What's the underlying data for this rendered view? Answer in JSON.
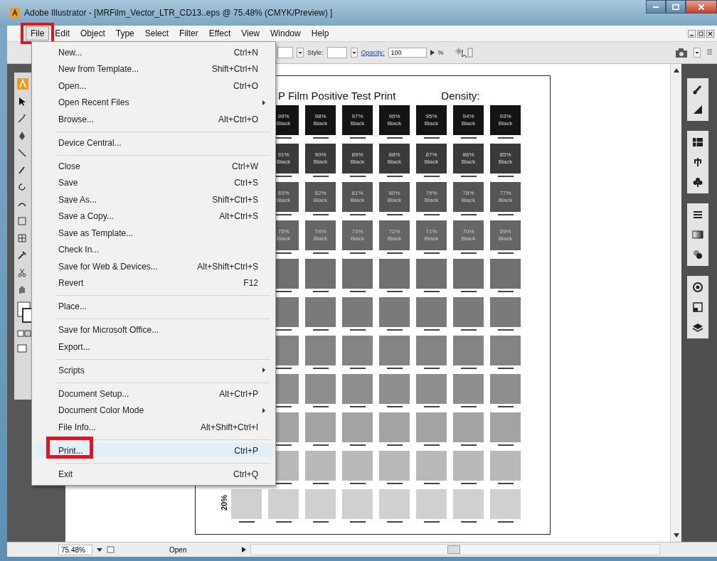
{
  "window": {
    "title": "Adobe Illustrator - [MRFilm_Vector_LTR_CD13..eps @ 75.48% (CMYK/Preview) ]"
  },
  "menu_bar": [
    {
      "label": "File",
      "selected": true,
      "marked": true
    },
    {
      "label": "Edit",
      "selected": false,
      "marked": false
    },
    {
      "label": "Object",
      "selected": false,
      "marked": false
    },
    {
      "label": "Type",
      "selected": false,
      "marked": false
    },
    {
      "label": "Select",
      "selected": false,
      "marked": false
    },
    {
      "label": "Filter",
      "selected": false,
      "marked": false
    },
    {
      "label": "Effect",
      "selected": false,
      "marked": false
    },
    {
      "label": "View",
      "selected": false,
      "marked": false
    },
    {
      "label": "Window",
      "selected": false,
      "marked": false
    },
    {
      "label": "Help",
      "selected": false,
      "marked": false
    }
  ],
  "control_bar": {
    "style_label": "Style:",
    "opacity_label": "Opacity:",
    "opacity_value": "100",
    "percent": "%"
  },
  "file_menu": [
    {
      "label": "New...",
      "shortcut": "Ctrl+N",
      "separator_before": false,
      "submenu": false,
      "selected": false,
      "marked": false
    },
    {
      "label": "New from Template...",
      "shortcut": "Shift+Ctrl+N",
      "separator_before": false,
      "submenu": false,
      "selected": false,
      "marked": false
    },
    {
      "label": "Open...",
      "shortcut": "Ctrl+O",
      "separator_before": false,
      "submenu": false,
      "selected": false,
      "marked": false
    },
    {
      "label": "Open Recent Files",
      "separator_before": false,
      "submenu": true,
      "selected": false,
      "marked": false
    },
    {
      "label": "Browse...",
      "shortcut": "Alt+Ctrl+O",
      "separator_before": false,
      "submenu": false,
      "selected": false,
      "marked": false
    },
    {
      "label": "Device Central...",
      "separator_before": true,
      "submenu": false,
      "selected": false,
      "marked": false
    },
    {
      "label": "Close",
      "shortcut": "Ctrl+W",
      "separator_before": true,
      "submenu": false,
      "selected": false,
      "marked": false
    },
    {
      "label": "Save",
      "shortcut": "Ctrl+S",
      "separator_before": false,
      "submenu": false,
      "selected": false,
      "marked": false
    },
    {
      "label": "Save As...",
      "shortcut": "Shift+Ctrl+S",
      "separator_before": false,
      "submenu": false,
      "selected": false,
      "marked": false
    },
    {
      "label": "Save a Copy...",
      "shortcut": "Alt+Ctrl+S",
      "separator_before": false,
      "submenu": false,
      "selected": false,
      "marked": false
    },
    {
      "label": "Save as Template...",
      "separator_before": false,
      "submenu": false,
      "selected": false,
      "marked": false
    },
    {
      "label": "Check In...",
      "separator_before": false,
      "submenu": false,
      "selected": false,
      "marked": false
    },
    {
      "label": "Save for Web & Devices...",
      "shortcut": "Alt+Shift+Ctrl+S",
      "separator_before": false,
      "submenu": false,
      "selected": false,
      "marked": false
    },
    {
      "label": "Revert",
      "shortcut": "F12",
      "separator_before": false,
      "submenu": false,
      "selected": false,
      "marked": false
    },
    {
      "label": "Place...",
      "separator_before": true,
      "submenu": false,
      "selected": false,
      "marked": false
    },
    {
      "label": "Save for Microsoft Office...",
      "separator_before": true,
      "submenu": false,
      "selected": false,
      "marked": false
    },
    {
      "label": "Export...",
      "separator_before": false,
      "submenu": false,
      "selected": false,
      "marked": false
    },
    {
      "label": "Scripts",
      "separator_before": true,
      "submenu": true,
      "selected": false,
      "marked": false
    },
    {
      "label": "Document Setup...",
      "shortcut": "Alt+Ctrl+P",
      "separator_before": true,
      "submenu": false,
      "selected": false,
      "marked": false
    },
    {
      "label": "Document Color Mode",
      "separator_before": false,
      "submenu": true,
      "selected": false,
      "marked": false
    },
    {
      "label": "File Info...",
      "shortcut": "Alt+Shift+Ctrl+I",
      "separator_before": false,
      "submenu": false,
      "selected": false,
      "marked": false
    },
    {
      "label": "Print...",
      "shortcut": "Ctrl+P",
      "separator_before": true,
      "submenu": false,
      "selected": true,
      "marked": true
    },
    {
      "label": "Exit",
      "shortcut": "Ctrl+Q",
      "separator_before": true,
      "submenu": false,
      "selected": false,
      "marked": false
    }
  ],
  "document": {
    "title": "P Film Positive Test Print",
    "density_label": "Density:",
    "rows": [
      {
        "color": "#141414",
        "cells": [
          {
            "kind": "labeled",
            "label": "99% Black"
          },
          {
            "kind": "labeled",
            "label": "98% Black"
          },
          {
            "kind": "labeled",
            "label": "97% Black"
          },
          {
            "kind": "labeled",
            "label": "96% Black"
          },
          {
            "kind": "labeled",
            "label": "95% Black"
          },
          {
            "kind": "labeled",
            "label": "94% Black"
          },
          {
            "kind": "labeled",
            "label": "93% Black"
          }
        ]
      },
      {
        "color": "#3a3a3a",
        "cells": [
          {
            "kind": "labeled",
            "label": "91% Black"
          },
          {
            "kind": "labeled",
            "label": "90% Black"
          },
          {
            "kind": "labeled",
            "label": "89% Black"
          },
          {
            "kind": "labeled",
            "label": "88% Black"
          },
          {
            "kind": "labeled",
            "label": "87% Black"
          },
          {
            "kind": "labeled",
            "label": "86% Black"
          },
          {
            "kind": "labeled",
            "label": "85% Black"
          }
        ]
      },
      {
        "color": "#555555",
        "cells": [
          {
            "kind": "labeled",
            "label": "83% Black"
          },
          {
            "kind": "labeled",
            "label": "82% Black"
          },
          {
            "kind": "labeled",
            "label": "81% Black"
          },
          {
            "kind": "labeled",
            "label": "80% Black"
          },
          {
            "kind": "labeled",
            "label": "79% Black"
          },
          {
            "kind": "labeled",
            "label": "78% Black"
          },
          {
            "kind": "labeled",
            "label": "77% Black"
          }
        ]
      },
      {
        "color": "#666666",
        "cells": [
          {
            "kind": "labeled",
            "label": "75% Black"
          },
          {
            "kind": "labeled",
            "label": "74% Black"
          },
          {
            "kind": "labeled",
            "label": "73% Black"
          },
          {
            "kind": "labeled",
            "label": "72% Black"
          },
          {
            "kind": "labeled",
            "label": "71% Black"
          },
          {
            "kind": "labeled",
            "label": "70% Black"
          },
          {
            "kind": "labeled",
            "label": "69% Black"
          }
        ]
      },
      {
        "color": "#707070",
        "cells": [
          {
            "kind": "blank"
          },
          {
            "kind": "blank"
          },
          {
            "kind": "blank"
          },
          {
            "kind": "blank"
          },
          {
            "kind": "blank"
          },
          {
            "kind": "blank"
          },
          {
            "kind": "blank"
          }
        ]
      },
      {
        "color": "#7a7a7a",
        "cells": [
          {
            "kind": "blank"
          },
          {
            "kind": "blank"
          },
          {
            "kind": "blank"
          },
          {
            "kind": "blank"
          },
          {
            "kind": "blank"
          },
          {
            "kind": "blank"
          },
          {
            "kind": "blank"
          }
        ]
      },
      {
        "color": "#848484",
        "cells": [
          {
            "kind": "blank"
          },
          {
            "kind": "blank"
          },
          {
            "kind": "blank"
          },
          {
            "kind": "blank"
          },
          {
            "kind": "blank"
          },
          {
            "kind": "blank"
          },
          {
            "kind": "blank"
          }
        ]
      },
      {
        "color": "#8e8e8e",
        "cells": [
          {
            "kind": "blank"
          },
          {
            "kind": "blank"
          },
          {
            "kind": "blank"
          },
          {
            "kind": "blank"
          },
          {
            "kind": "blank"
          },
          {
            "kind": "blank"
          },
          {
            "kind": "blank"
          }
        ]
      },
      {
        "color": "#a3a3a3",
        "cells": [
          {
            "kind": "blank"
          },
          {
            "kind": "blank"
          },
          {
            "kind": "blank"
          },
          {
            "kind": "blank"
          },
          {
            "kind": "blank"
          },
          {
            "kind": "blank"
          },
          {
            "kind": "blank"
          }
        ]
      },
      {
        "color": "#b9b9b9",
        "cells": [
          {
            "kind": "blank"
          },
          {
            "kind": "blank"
          },
          {
            "kind": "blank"
          },
          {
            "kind": "blank"
          },
          {
            "kind": "blank"
          },
          {
            "kind": "blank"
          },
          {
            "kind": "blank"
          }
        ]
      },
      {
        "color": "#d0d0d0",
        "side_label": "20%",
        "cells": [
          {
            "kind": "blank"
          },
          {
            "kind": "blank"
          },
          {
            "kind": "blank"
          },
          {
            "kind": "blank"
          },
          {
            "kind": "blank"
          },
          {
            "kind": "blank"
          },
          {
            "kind": "blank"
          },
          {
            "kind": "blank"
          }
        ]
      }
    ]
  },
  "status_bar": {
    "zoom": "75.48%",
    "status": "Open"
  }
}
